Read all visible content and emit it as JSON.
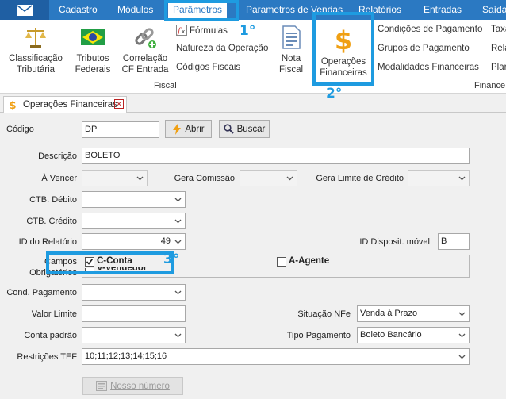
{
  "menu": {
    "tabs": [
      "Cadastro",
      "Módulos",
      "Parâmetros",
      "Parametros de Vendas",
      "Relatórios",
      "Entradas",
      "Saídas"
    ]
  },
  "ribbon": {
    "fiscal_buttons": {
      "classificacao": [
        "Classificação",
        "Tributária"
      ],
      "tributos": [
        "Tributos",
        "Federais"
      ],
      "correlacao": [
        "Correlação",
        "CF Entrada"
      ]
    },
    "fiscal_small": [
      "Fórmulas",
      "Natureza da Operação",
      "Códigos Fiscais"
    ],
    "nota_fiscal": [
      "Nota",
      "Fiscal"
    ],
    "fiscal_group_label": "Fiscal",
    "operacoes": [
      "Operações",
      "Financeiras"
    ],
    "finance_small": [
      "Condições de Pagamento",
      "Grupos de Pagamento",
      "Modalidades Financeiras"
    ],
    "finance_small_cut": [
      "Taxa",
      "Rela",
      "Plar"
    ],
    "finance_group_label": "Finance"
  },
  "doc_tab": {
    "title": "Operações Financeiras"
  },
  "form": {
    "codigo_label": "Código",
    "codigo_value": "DP",
    "abrir_label": "Abrir",
    "buscar_label": "Buscar",
    "descricao_label": "Descrição",
    "descricao_value": "BOLETO",
    "a_vencer_label": "À Vencer",
    "gera_comissao_label": "Gera Comissão",
    "gera_limite_label": "Gera Limite de Crédito",
    "ctb_debito_label": "CTB. Débito",
    "ctb_credito_label": "CTB. Crédito",
    "id_relatorio_label": "ID do Relatório",
    "id_relatorio_value": "49",
    "id_dispositivo_label": "ID Disposit. móvel",
    "id_dispositivo_value": "B",
    "campos_label": "Campos",
    "obrigatorios_label": "Obrigatórios",
    "c_conta_label": "C-Conta",
    "a_agente_label": "A-Agente",
    "v_vendedor_label": "V-Vendedor",
    "cond_pagamento_label": "Cond. Pagamento",
    "valor_limite_label": "Valor Limite",
    "situacao_nfe_label": "Situação NFe",
    "situacao_nfe_value": "Venda à Prazo",
    "conta_padrao_label": "Conta padrão",
    "tipo_pagamento_label": "Tipo Pagamento",
    "tipo_pagamento_value": "Boleto Bancário",
    "restricoes_tef_label": "Restrições TEF",
    "restricoes_tef_value": "10;11;12;13;14;15;16",
    "nosso_numero_label": "Nosso número"
  },
  "annotations": {
    "step1": "1°",
    "step2": "2°",
    "step3": "3°"
  },
  "colors": {
    "menu_bar": "#2b79c2",
    "highlight": "#1e9be0"
  }
}
